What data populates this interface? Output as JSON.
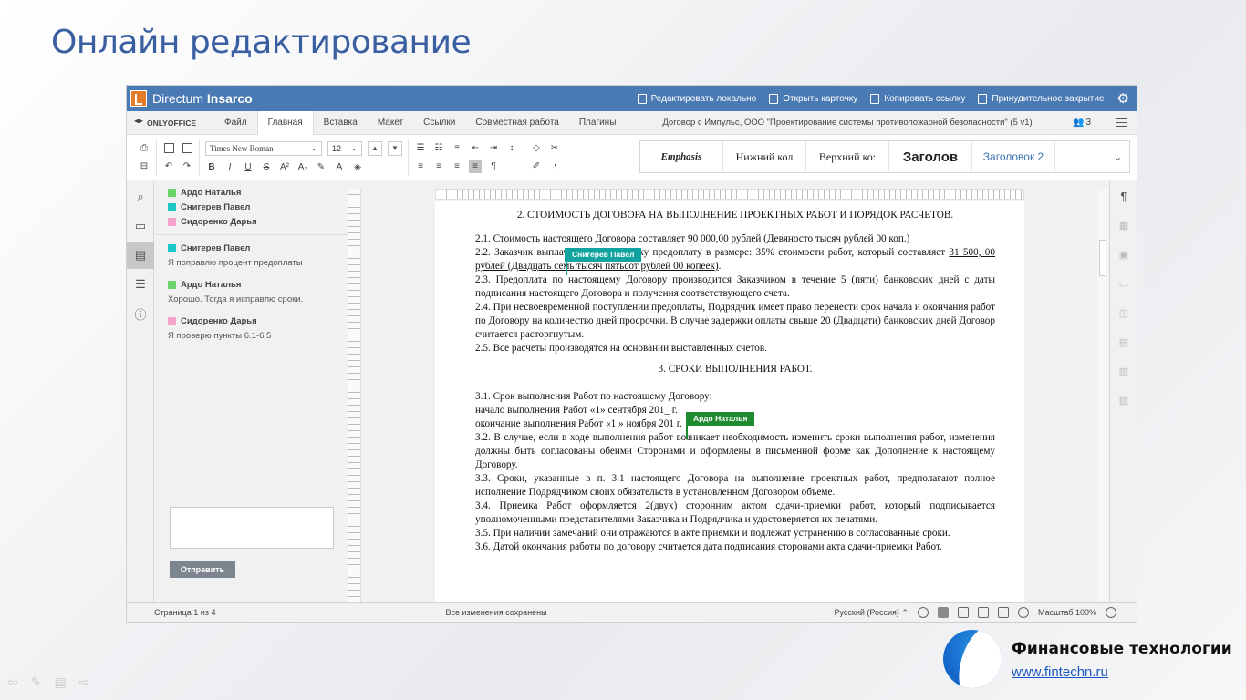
{
  "slide": {
    "title": "Онлайн редактирование"
  },
  "topbar": {
    "logo_word1": "Directum",
    "logo_word2": "Insarco",
    "actions": [
      "Редактировать локально",
      "Открыть карточку",
      "Копировать ссылку",
      "Принудительное закрытие"
    ]
  },
  "menubar": {
    "brand": "ONLYOFFICE",
    "items": [
      "Файл",
      "Главная",
      "Вставка",
      "Макет",
      "Ссылки",
      "Совместная работа",
      "Плагины"
    ],
    "active_item": "Главная",
    "doc_title": "Договор с Импульс, ООО \"Проектирование системы противопожарной безопасности\" (5 v1)",
    "users_count": "3"
  },
  "toolbar": {
    "font": "Times New Roman",
    "size": "12",
    "styles": [
      "Emphasis",
      "Нижний кол",
      "Верхний ко:",
      "Заголов",
      "Заголовок 2"
    ]
  },
  "comments": {
    "top_users": [
      {
        "name": "Ардо Наталья",
        "color": "#6ad36a"
      },
      {
        "name": "Снигерев Павел",
        "color": "#1fc6c6"
      },
      {
        "name": "Сидоренко Дарья",
        "color": "#f3a4c8"
      }
    ],
    "threads": [
      {
        "name": "Снигерев Павел",
        "color": "#1fc6c6",
        "text": "Я поправлю процент предоплаты"
      },
      {
        "name": "Ардо Наталья",
        "color": "#6ad36a",
        "text": "Хорошо. Тогда я исправлю сроки."
      },
      {
        "name": "Сидоренко Дарья",
        "color": "#f3a4c8",
        "text": "Я проверю пункты 6.1-6.5"
      }
    ],
    "send_label": "Отправить"
  },
  "document": {
    "heading1": "2. СТОИМОСТЬ ДОГОВОРА НА ВЫПОЛНЕНИЕ ПРОЕКТНЫХ РАБОТ И ПОРЯДОК РАСЧЕТОВ.",
    "p21": "2.1. Стоимость настоящего Договора составляет 90 000,00 рублей (Девяносто тысяч рублей 00 коп.)",
    "p22a": "2.2. Заказчик выплачивает Подрядчику предоплату в размере: 35% стоимости работ, который составляет ",
    "p22u": "31 500, 00 рублей (Двадцать семь тысяч пятьсот рублей 00 копеек)",
    "p22b": ".",
    "p23": "2.3. Предоплата по настоящему Договору производится Заказчиком в течение 5 (пяти) банковских дней с даты подписания настоящего Договора и получения соответствующего счета.",
    "p24": "2.4. При несвоевременной поступлении предоплаты, Подрядчик имеет право перенести срок начала и окончания работ по Договору на количество дней просрочки. В случае задержки оплаты свыше 20 (Двадцати) банковских дней Договор считается расторгнутым.",
    "p25": "2.5. Все расчеты производятся на основании выставленных счетов.",
    "heading2": "3. СРОКИ ВЫПОЛНЕНИЯ РАБОТ.",
    "p31": "3.1. Срок выполнения Работ по настоящему Договору:",
    "p31a": "начало выполнения Работ «1» сентября 201_ г.",
    "p31b": "окончание выполнения Работ «1 » ноября 201  г.",
    "p32": "3.2. В случае, если в ходе выполнения работ возникает необходимость изменить сроки выполнения работ, изменения должны быть согласованы обеими Сторонами и оформлены в письменной форме как Дополнение к настоящему Договору.",
    "p33": "3.3. Сроки, указанные в п. 3.1 настоящего Договора на выполнение проектных работ, предполагают полное исполнение Подрядчиком своих обязательств в установленном Договором объеме.",
    "p34": "3.4. Приемка Работ оформляется 2(двух) сторонним актом сдачи-приемки работ, который подписывается уполномоченными представителями Заказчика и Подрядчика и удостоверяется их печатями.",
    "p35": "3.5. При наличии замечаний они отражаются в акте приемки и подлежат устранению в согласованные сроки.",
    "p36": "3.6. Датой окончания работы по договору считается дата подписания сторонами акта сдачи-приемки Работ."
  },
  "cursors": {
    "pavel": {
      "name": "Снигерев Павел",
      "color": "#11a3a0"
    },
    "ardo": {
      "name": "Ардо Наталья",
      "color": "#1f8a2f"
    }
  },
  "statusbar": {
    "page": "Страница 1 из 4",
    "saved": "Все изменения сохранены",
    "language": "Русский (Россия)",
    "zoom": "Масштаб 100%"
  },
  "footer": {
    "brand": "Финансовые технологии",
    "url": "www.fintechn.ru"
  }
}
